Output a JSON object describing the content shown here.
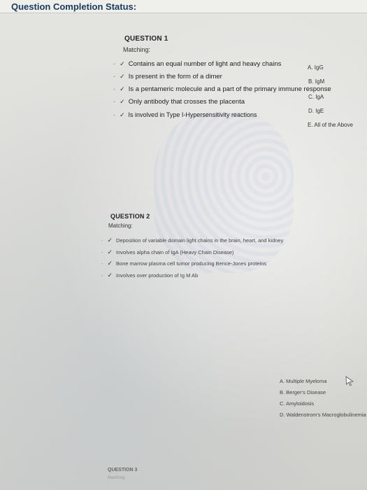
{
  "header": {
    "status_title": "Question Completion Status:"
  },
  "question1": {
    "title": "QUESTION 1",
    "type_label": "Matching:",
    "items": [
      "Contains an equal number of light and heavy chains",
      "Is present in the form of a dimer",
      "Is a pentameric molecule and a part of the primary immune response",
      "Only antibody that crosses the placenta",
      "Is involved in Type I-Hypersensitivity reactions"
    ],
    "options": [
      "A. IgG",
      "B. IgM",
      "C. IgA",
      "D. IgE",
      "E. All of the Above"
    ]
  },
  "question2": {
    "title": "QUESTION 2",
    "type_label": "Matching:",
    "items": [
      "Deposition of variable domain light chains in the brain, heart, and kidney",
      "Involves alpha chain of IgA (Heavy Chain Disease)",
      "Bone marrow plasma cell tumor producing Bence-Jones proteins",
      "Involves over production of Ig M Ab"
    ],
    "options": [
      "A. Multiple Myeloma",
      "B. Berger's Disease",
      "C. Amyloidosis",
      "D. Waldenstrom's Macroglobulinemia"
    ]
  },
  "question3": {
    "title": "QUESTION 3",
    "type_label": "Matching:"
  }
}
